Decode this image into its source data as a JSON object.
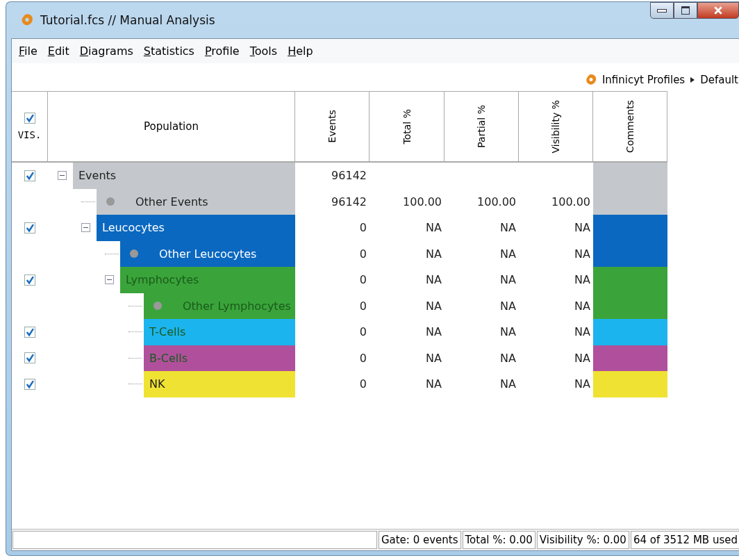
{
  "window": {
    "title": "Tutorial.fcs // Manual Analysis"
  },
  "menu": [
    "File",
    "Edit",
    "Diagrams",
    "Statistics",
    "Profile",
    "Tools",
    "Help"
  ],
  "toolbar": {
    "profiles_label": "Infinicyt Profiles",
    "profile": "Default"
  },
  "table": {
    "vis_header": {
      "label": "VIS.",
      "checked": true
    },
    "columns": [
      "Population",
      "Events",
      "Total %",
      "Partial %",
      "Visibility %",
      "Comments"
    ],
    "rows": [
      {
        "kind": "population",
        "name": "Events",
        "checked": true,
        "expanded": true,
        "color": "#c4c8cc",
        "events": "96142",
        "children": [
          {
            "kind": "remainder",
            "name": "Other Events",
            "color": "#c4c8cc",
            "events": "96142",
            "total": "100.00",
            "partial": "100.00",
            "visibility": "100.00"
          },
          {
            "kind": "population",
            "name": "Leucocytes",
            "checked": true,
            "expanded": true,
            "color": "#0a68c0",
            "events": "0",
            "total": "NA",
            "partial": "NA",
            "visibility": "NA",
            "children": [
              {
                "kind": "remainder",
                "name": "Other Leucocytes",
                "color": "#0a68c0",
                "events": "0",
                "total": "NA",
                "partial": "NA",
                "visibility": "NA"
              },
              {
                "kind": "population",
                "name": "Lymphocytes",
                "checked": true,
                "expanded": true,
                "color": "#3aa43a",
                "events": "0",
                "total": "NA",
                "partial": "NA",
                "visibility": "NA",
                "children": [
                  {
                    "kind": "remainder",
                    "name": "Other Lymphocytes",
                    "color": "#3aa43a",
                    "events": "0",
                    "total": "NA",
                    "partial": "NA",
                    "visibility": "NA"
                  },
                  {
                    "kind": "population",
                    "name": "T-Cells",
                    "checked": true,
                    "color": "#1cb4ee",
                    "events": "0",
                    "total": "NA",
                    "partial": "NA",
                    "visibility": "NA"
                  },
                  {
                    "kind": "population",
                    "name": "B-Cells",
                    "checked": true,
                    "color": "#b0509c",
                    "events": "0",
                    "total": "NA",
                    "partial": "NA",
                    "visibility": "NA"
                  },
                  {
                    "kind": "population",
                    "name": "NK",
                    "checked": true,
                    "color": "#f0e232",
                    "events": "0",
                    "total": "NA",
                    "partial": "NA",
                    "visibility": "NA"
                  }
                ]
              }
            ]
          }
        ]
      }
    ]
  },
  "status_bar": [
    "Gate: 0 events",
    "Total %: 0.00",
    "Visibility %: 0.00",
    "64 of 3512 MB used"
  ]
}
